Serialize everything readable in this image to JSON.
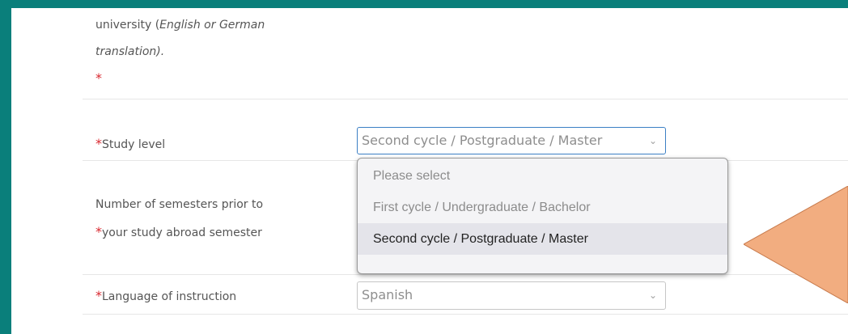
{
  "form": {
    "partial_label": {
      "line1_prefix": "university (",
      "line1_italic": "English or German",
      "line2": "translation).",
      "required_mark": "*"
    },
    "study_level": {
      "required_mark": "*",
      "label": "Study level",
      "value": "Second cycle / Postgraduate / Master",
      "chevron": "chevron-down-icon",
      "dropdown_open": true,
      "options": [
        "Please select",
        "First cycle / Undergraduate / Bachelor",
        "Second cycle / Postgraduate / Master"
      ],
      "selected_index": 2
    },
    "semesters": {
      "required_mark": "*",
      "label_line1": "Number of semesters prior to",
      "label_line2": "your study abroad semester"
    },
    "language": {
      "required_mark": "*",
      "label": "Language of instruction",
      "value": "Spanish",
      "chevron": "chevron-down-icon"
    }
  },
  "colors": {
    "frame": "#0a7f7b",
    "required": "#d9282f",
    "callout_fill": "#f2ad80",
    "callout_stroke": "#c77a4c",
    "focus_border": "#3b7fc4"
  }
}
